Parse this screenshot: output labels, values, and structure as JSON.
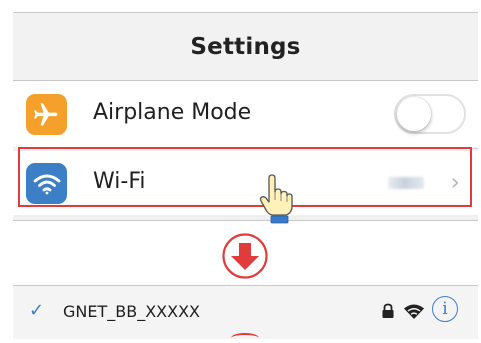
{
  "settings": {
    "title": "Settings",
    "rows": [
      {
        "label": "Airplane Mode",
        "icon": "airplane-icon",
        "icon_color": "#f5a02b",
        "control": "toggle",
        "toggle_on": false
      },
      {
        "label": "Wi-Fi",
        "icon": "wifi-icon",
        "icon_color": "#3d7fc6",
        "control": "disclosure",
        "value_obscured": true
      }
    ]
  },
  "callout": {
    "highlight_color": "#e23b3b",
    "arrow_icon": "down-arrow-icon",
    "cursor_icon": "hand-pointer-icon"
  },
  "network": {
    "check_icon": "checkmark-icon",
    "name": "GNET_BB_XXXXX",
    "lock_icon": "lock-icon",
    "signal_icon": "wifi-signal-icon",
    "info_icon": "info-icon",
    "info_glyph": "i"
  },
  "colors": {
    "accent_blue": "#3d7fc6",
    "highlight_red": "#e23b3b",
    "airplane_orange": "#f5a02b"
  }
}
